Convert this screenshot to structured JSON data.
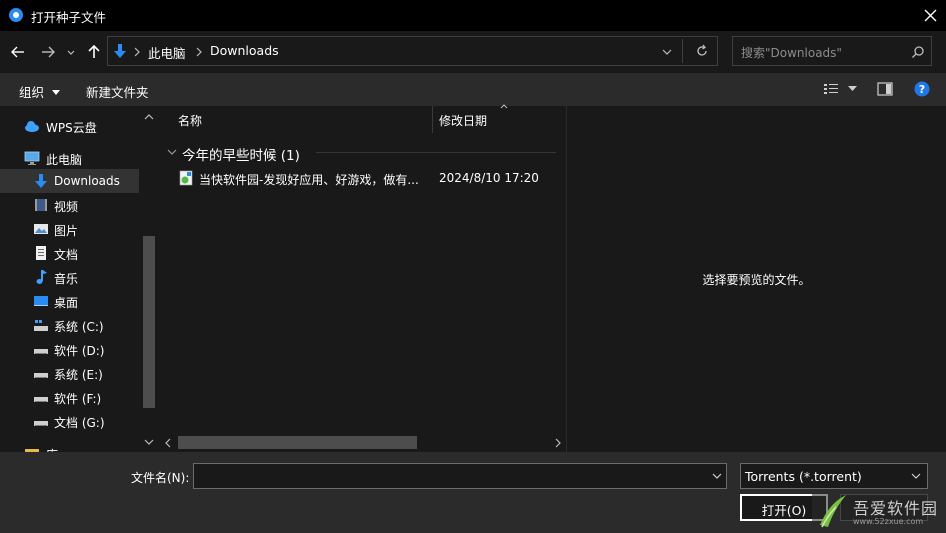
{
  "window": {
    "title": "打开种子文件"
  },
  "address": {
    "breadcrumb": [
      "此电脑",
      "Downloads"
    ]
  },
  "search": {
    "placeholder": "搜索\"Downloads\""
  },
  "toolbar": {
    "organize": "组织",
    "new_folder": "新建文件夹"
  },
  "sidebar": {
    "items": [
      {
        "label": "WPS云盘",
        "icon": "cloud-icon"
      },
      {
        "label": "此电脑",
        "icon": "computer-icon"
      },
      {
        "label": "Downloads",
        "icon": "download-arrow-icon",
        "selected": true
      },
      {
        "label": "视频",
        "icon": "video-icon"
      },
      {
        "label": "图片",
        "icon": "picture-icon"
      },
      {
        "label": "文档",
        "icon": "document-icon"
      },
      {
        "label": "音乐",
        "icon": "music-icon"
      },
      {
        "label": "桌面",
        "icon": "desktop-icon"
      },
      {
        "label": "系统 (C:)",
        "icon": "system-drive-icon"
      },
      {
        "label": "软件 (D:)",
        "icon": "drive-icon"
      },
      {
        "label": "系统 (E:)",
        "icon": "drive-icon"
      },
      {
        "label": "软件 (F:)",
        "icon": "drive-icon"
      },
      {
        "label": "文档 (G:)",
        "icon": "drive-icon"
      },
      {
        "label": "库",
        "icon": "library-icon"
      }
    ]
  },
  "filelist": {
    "columns": {
      "name": "名称",
      "date": "修改日期"
    },
    "group": "今年的早些时候 (1)",
    "files": [
      {
        "name": "当快软件园-发现好应用、好游戏，做有...",
        "date": "2024/8/10 17:20"
      }
    ]
  },
  "preview": {
    "message": "选择要预览的文件。"
  },
  "bottom": {
    "filename_label": "文件名(N):",
    "filename_value": "",
    "filetype": "Torrents (*.torrent)",
    "open_button": "打开(O)"
  },
  "watermark": {
    "text": "吾爱软件园",
    "sub": "www.52zxue.com"
  },
  "colors": {
    "background": "#191919",
    "titlebar": "#000000",
    "toolbar": "#2b2b2b",
    "accent": "#2a8cf0",
    "help": "#1e78e6"
  }
}
